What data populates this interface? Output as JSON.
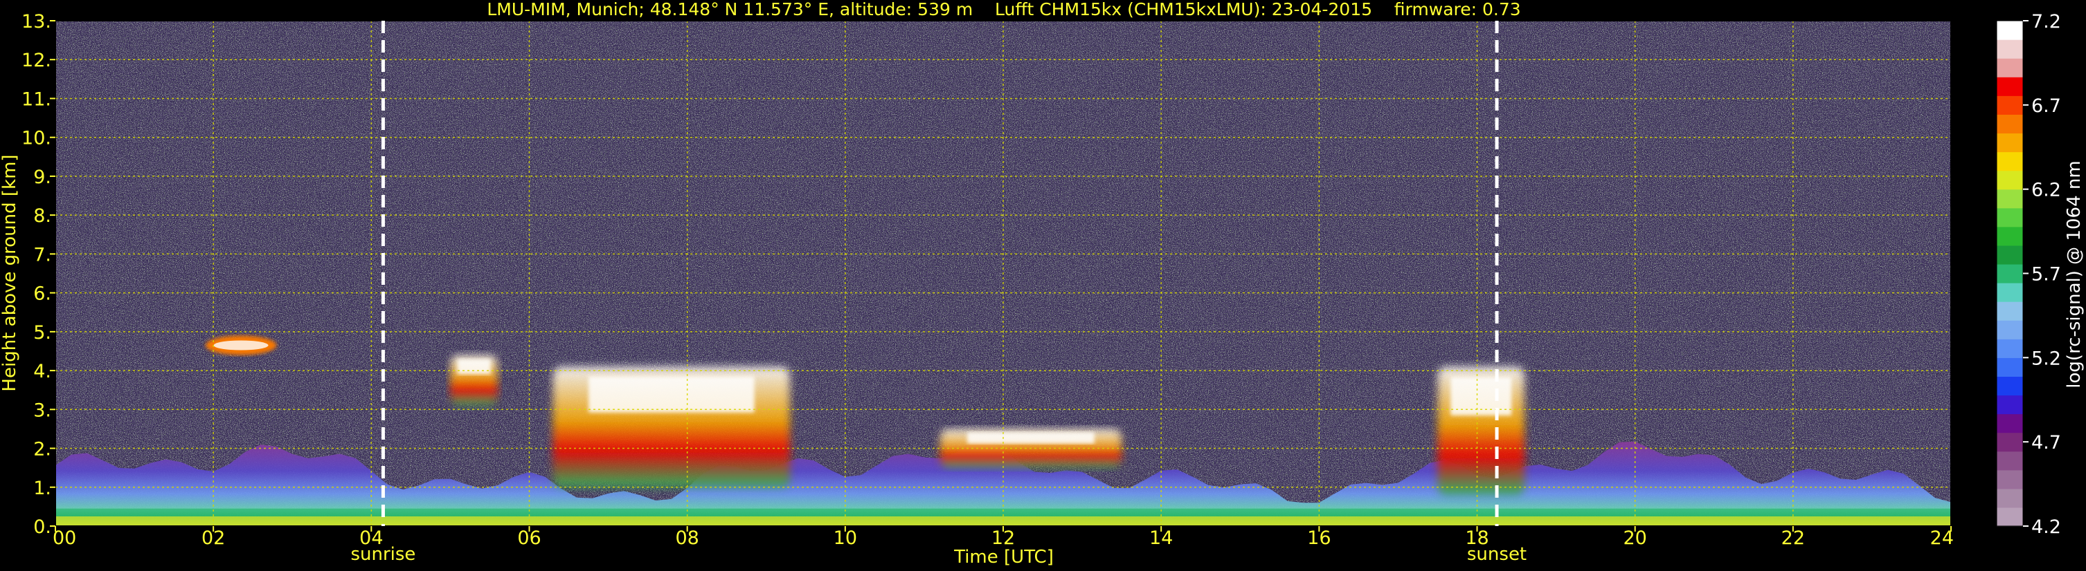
{
  "chart_data": {
    "type": "heatmap",
    "title": "LMU-MIM, Munich; 48.148° N 11.573° E, altitude: 539 m    Lufft CHM15kx (CHM15kxLMU): 23-04-2015    firmware: 0.73",
    "xlabel": "Time [UTC]",
    "ylabel": "Height above ground [km]",
    "xlim": [
      0,
      24
    ],
    "ylim": [
      0,
      13
    ],
    "x_ticks": [
      0,
      2,
      4,
      6,
      8,
      10,
      12,
      14,
      16,
      18,
      20,
      22,
      24
    ],
    "x_tick_labels": [
      "00",
      "02",
      "04",
      "06",
      "08",
      "10",
      "12",
      "14",
      "16",
      "18",
      "20",
      "22",
      "24"
    ],
    "y_ticks": [
      0,
      1,
      2,
      3,
      4,
      5,
      6,
      7,
      8,
      9,
      10,
      11,
      12,
      13
    ],
    "y_tick_labels": [
      "0.",
      "1.",
      "2.",
      "3.",
      "4.",
      "5.",
      "6.",
      "7.",
      "8.",
      "9.",
      "10.",
      "11.",
      "12.",
      "13."
    ],
    "grid": true,
    "markers": [
      {
        "label": "sunrise",
        "x": 4.15
      },
      {
        "label": "sunset",
        "x": 18.25
      }
    ],
    "colorbar": {
      "label": "log(rc-signal) @ 1064 nm",
      "min": 4.2,
      "max": 7.2,
      "ticks": [
        4.2,
        4.7,
        5.2,
        5.7,
        6.2,
        6.7,
        7.2
      ],
      "tick_labels": [
        "4.2",
        "4.7",
        "5.2",
        "5.7",
        "6.2",
        "6.7",
        "7.2"
      ],
      "colors": [
        "#b8a0b8",
        "#a88aa8",
        "#9a6f9a",
        "#8a4f8a",
        "#7a2a7a",
        "#6a0d8a",
        "#3a1ad0",
        "#1a3ef0",
        "#3a6ef5",
        "#5a8ef5",
        "#7aaaf0",
        "#8ec2ea",
        "#5ad0c0",
        "#2ab870",
        "#1a9a3a",
        "#2ab830",
        "#5ad040",
        "#9ae040",
        "#d8e820",
        "#f8d800",
        "#f8a800",
        "#f87800",
        "#f84000",
        "#f00000",
        "#e8a0a0",
        "#f0d0d0",
        "#ffffff"
      ]
    },
    "features": [
      {
        "name": "boundary-layer",
        "x_start": 0,
        "x_end": 24,
        "height_km": [
          0,
          2.2
        ]
      },
      {
        "name": "elevated-aerosol-layer",
        "x_start": 1.9,
        "x_end": 2.8,
        "height_km": [
          4.4,
          4.9
        ]
      },
      {
        "name": "cloud",
        "x_start": 5.0,
        "x_end": 5.6,
        "height_km": [
          3.1,
          4.4
        ]
      },
      {
        "name": "cloud",
        "x_start": 6.3,
        "x_end": 9.3,
        "height_km": [
          1.0,
          4.1
        ]
      },
      {
        "name": "cloud",
        "x_start": 11.2,
        "x_end": 13.5,
        "height_km": [
          1.5,
          2.5
        ]
      },
      {
        "name": "cloud",
        "x_start": 17.5,
        "x_end": 18.6,
        "height_km": [
          0.8,
          4.1
        ]
      }
    ],
    "colors": {
      "text": "#ffff33",
      "grid": "#d8d800",
      "marker": "#ffffff",
      "background": "#000000"
    }
  }
}
